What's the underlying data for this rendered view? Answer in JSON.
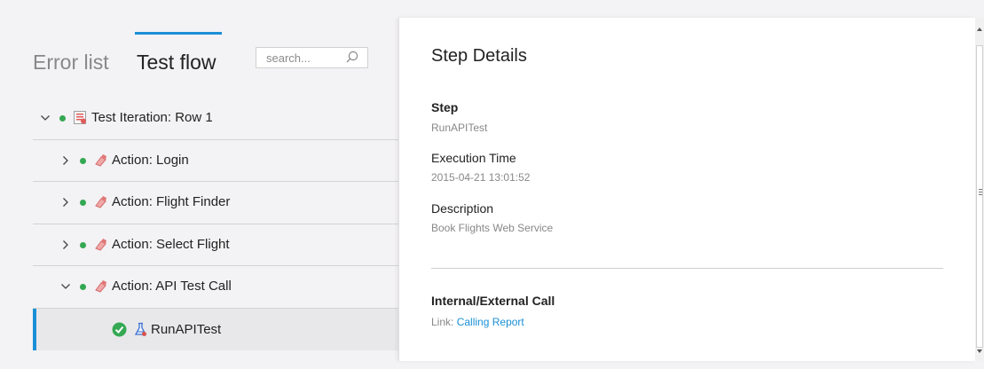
{
  "tabs": {
    "error_list": "Error list",
    "test_flow": "Test flow",
    "active": "test_flow"
  },
  "search": {
    "placeholder": "search..."
  },
  "tree": [
    {
      "label": "Test Iteration: Row 1",
      "level": 0,
      "expanded": true,
      "icon": "test-iteration-icon",
      "status": "passed"
    },
    {
      "label": "Action: Login",
      "level": 1,
      "expanded": false,
      "icon": "action-icon",
      "status": "passed"
    },
    {
      "label": "Action: Flight Finder",
      "level": 1,
      "expanded": false,
      "icon": "action-icon",
      "status": "passed"
    },
    {
      "label": "Action: Select Flight",
      "level": 1,
      "expanded": false,
      "icon": "action-icon",
      "status": "passed"
    },
    {
      "label": "Action: API Test Call",
      "level": 1,
      "expanded": true,
      "icon": "action-icon",
      "status": "passed"
    },
    {
      "label": "RunAPITest",
      "level": 2,
      "selected": true,
      "icon": "api-test-icon",
      "status": "passed"
    }
  ],
  "details": {
    "title": "Step Details",
    "step_label": "Step",
    "step_value": "RunAPITest",
    "exec_label": "Execution Time",
    "exec_value": "2015-04-21 13:01:52",
    "desc_label": "Description",
    "desc_value": "Book Flights Web Service",
    "call_label": "Internal/External Call",
    "link_prefix": "Link:",
    "link_text": "Calling Report"
  },
  "colors": {
    "accent": "#1a8fd6",
    "passed": "#34a853",
    "background": "#f3f2f4"
  }
}
